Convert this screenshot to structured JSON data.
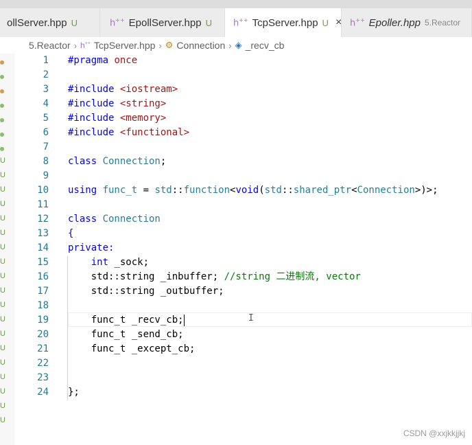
{
  "tabs": [
    {
      "label": "ollServer.hpp",
      "status": "U"
    },
    {
      "label": "EpollServer.hpp",
      "status": "U"
    },
    {
      "label": "TcpServer.hpp",
      "status": "U",
      "close": "×"
    },
    {
      "label": "Epoller.hpp",
      "status": "5.Reactor"
    }
  ],
  "breadcrumb": {
    "folder": "5.Reactor",
    "file": "TcpServer.hpp",
    "class": "Connection",
    "member": "_recv_cb",
    "sep": "›"
  },
  "gutter_marker": "U",
  "lines": [
    {
      "n": "1",
      "t": [
        [
          "pp",
          "#pragma "
        ],
        [
          "str",
          "once"
        ]
      ]
    },
    {
      "n": "2",
      "t": []
    },
    {
      "n": "3",
      "t": [
        [
          "pp",
          "#include "
        ],
        [
          "str",
          "<iostream>"
        ]
      ]
    },
    {
      "n": "4",
      "t": [
        [
          "pp",
          "#include "
        ],
        [
          "str",
          "<string>"
        ]
      ]
    },
    {
      "n": "5",
      "t": [
        [
          "pp",
          "#include "
        ],
        [
          "str",
          "<memory>"
        ]
      ]
    },
    {
      "n": "6",
      "t": [
        [
          "pp",
          "#include "
        ],
        [
          "str",
          "<functional>"
        ]
      ]
    },
    {
      "n": "7",
      "t": []
    },
    {
      "n": "8",
      "t": [
        [
          "kw",
          "class "
        ],
        [
          "ty",
          "Connection"
        ],
        [
          "",
          "; "
        ]
      ]
    },
    {
      "n": "9",
      "t": []
    },
    {
      "n": "10",
      "t": [
        [
          "kw",
          "using "
        ],
        [
          "ty",
          "func_t"
        ],
        [
          "",
          " = "
        ],
        [
          "ty",
          "std"
        ],
        [
          "",
          "::"
        ],
        [
          "ty",
          "function"
        ],
        [
          "",
          "<"
        ],
        [
          "kw",
          "void"
        ],
        [
          "",
          "("
        ],
        [
          "ty",
          "std"
        ],
        [
          "",
          "::"
        ],
        [
          "ty",
          "shared_ptr"
        ],
        [
          "",
          "<"
        ],
        [
          "ty",
          "Connection"
        ],
        [
          "",
          ">)>;"
        ]
      ]
    },
    {
      "n": "11",
      "t": []
    },
    {
      "n": "12",
      "t": [
        [
          "kw",
          "class "
        ],
        [
          "ty",
          "Connection"
        ]
      ]
    },
    {
      "n": "13",
      "t": [
        [
          "kw",
          "{"
        ]
      ]
    },
    {
      "n": "14",
      "t": [
        [
          "kw",
          "private"
        ],
        [
          "kw",
          ":"
        ]
      ]
    },
    {
      "n": "15",
      "t": [
        [
          "",
          "    "
        ],
        [
          "kw",
          "int"
        ],
        [
          "",
          " _sock;"
        ]
      ]
    },
    {
      "n": "16",
      "t": [
        [
          "",
          "    std::string _inbuffer; "
        ],
        [
          "cm",
          "//string 二进制流, vector"
        ]
      ]
    },
    {
      "n": "17",
      "t": [
        [
          "",
          "    std::string _outbuffer;"
        ]
      ]
    },
    {
      "n": "18",
      "t": []
    },
    {
      "n": "19",
      "t": [
        [
          "",
          "    func_t _recv_cb;"
        ]
      ],
      "caret": true
    },
    {
      "n": "20",
      "t": [
        [
          "",
          "    func_t _send_cb;"
        ]
      ]
    },
    {
      "n": "21",
      "t": [
        [
          "",
          "    func_t _except_cb;"
        ]
      ]
    },
    {
      "n": "22",
      "t": []
    },
    {
      "n": "23",
      "t": []
    },
    {
      "n": "24",
      "t": [
        [
          "",
          "};"
        ]
      ]
    }
  ],
  "watermark": "CSDN @xxjkkjjkj"
}
